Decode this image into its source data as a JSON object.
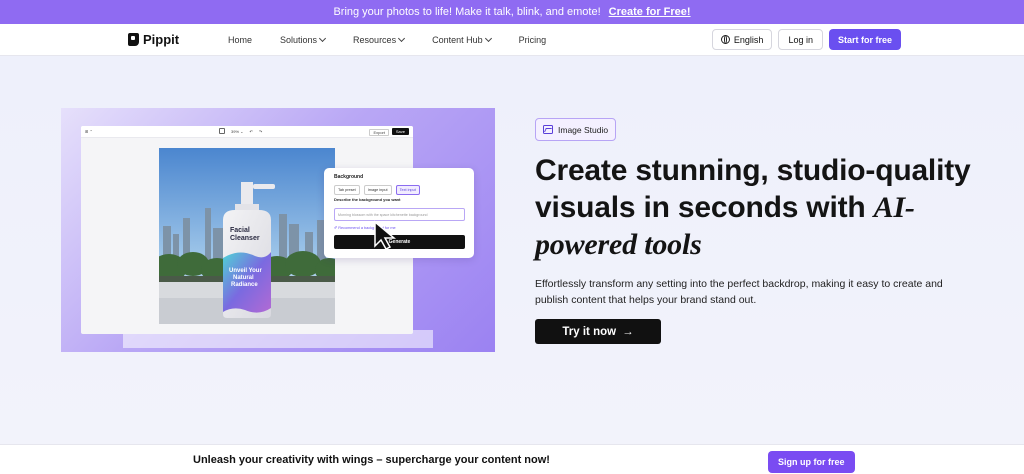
{
  "promo": {
    "text": "Bring your photos to life! Make it talk, blink, and emote!",
    "link": "Create for Free!"
  },
  "nav": {
    "brand": "Pippit",
    "items": [
      {
        "label": "Home",
        "has_dropdown": false
      },
      {
        "label": "Solutions",
        "has_dropdown": true
      },
      {
        "label": "Resources",
        "has_dropdown": true
      },
      {
        "label": "Content Hub",
        "has_dropdown": true
      },
      {
        "label": "Pricing",
        "has_dropdown": false
      }
    ],
    "language": "English",
    "login": "Log in",
    "start": "Start for free"
  },
  "mockup": {
    "toolbar_left": "⊞ ⌃",
    "toolbar_zoom": "39% ⌄",
    "export": "Export",
    "save": "Save",
    "product": {
      "brand_line1": "Facial",
      "brand_line2": "Cleanser",
      "tagline1": "Unveil Your",
      "tagline2": "Natural",
      "tagline3": "Radiance"
    },
    "panel": {
      "title": "Background",
      "tabs": [
        "Tab preset",
        "Image input",
        "Text input"
      ],
      "active_tab": 2,
      "description_label": "Describe the background you want",
      "input_placeholder": "Morning blossom with the space kitchenette background",
      "recommend": "✐ Recommend a background for me",
      "generate": "Generate"
    }
  },
  "hero": {
    "badge": "Image Studio",
    "headline_plain": "Create stunning, studio-quality visuals in seconds with ",
    "headline_em": "AI-powered tools",
    "subtext": "Effortlessly transform any setting into the perfect backdrop, making it easy to create and publish content that helps your brand stand out.",
    "cta": "Try it now",
    "cta_arrow": "→"
  },
  "footer": {
    "text": "Unleash your creativity with wings – supercharge your content now!",
    "signup": "Sign up for free"
  },
  "colors": {
    "promo_bg": "#8f6bf2",
    "primary": "#6a4ff0",
    "signup": "#7a4cf2"
  }
}
